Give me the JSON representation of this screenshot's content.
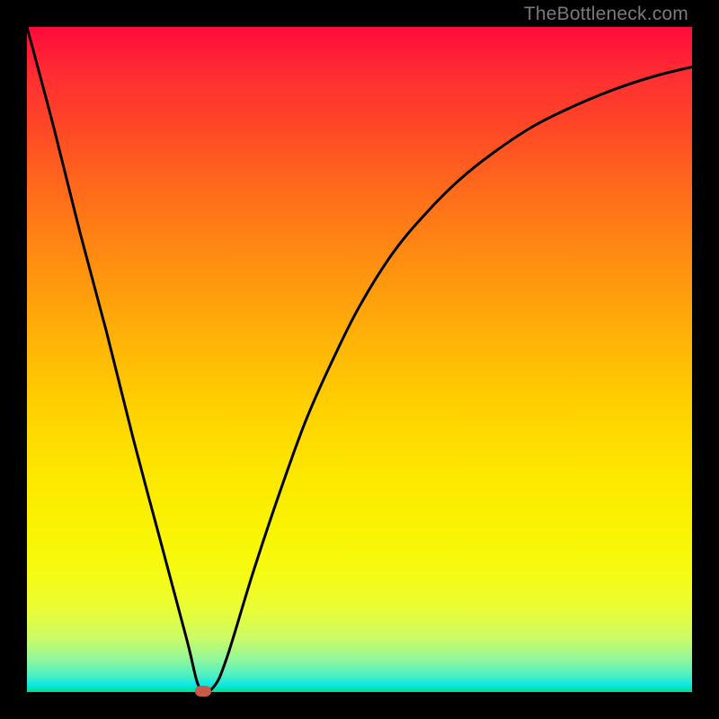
{
  "watermark": "TheBottleneck.com",
  "colors": {
    "page_bg": "#000000",
    "curve": "#000000",
    "marker": "#cc5a4a",
    "watermark": "#7a7a7a"
  },
  "chart_data": {
    "type": "line",
    "title": "",
    "xlabel": "",
    "ylabel": "",
    "xlim": [
      0,
      100
    ],
    "ylim": [
      0,
      100
    ],
    "grid": false,
    "legend": false,
    "series": [
      {
        "name": "bottleneck-curve",
        "x": [
          0,
          4,
          8,
          12,
          16,
          20,
          24,
          26,
          28,
          30,
          34,
          38,
          42,
          46,
          50,
          55,
          60,
          65,
          70,
          76,
          82,
          88,
          94,
          100
        ],
        "y": [
          100,
          85,
          69,
          54,
          38,
          23,
          8,
          0.5,
          0.7,
          5,
          18,
          30,
          41,
          50,
          58,
          66,
          72,
          77,
          81,
          85,
          88,
          90.5,
          92.5,
          94
        ]
      }
    ],
    "annotations": [
      {
        "name": "minimum-marker",
        "x": 26.5,
        "y": 0.2
      }
    ]
  }
}
